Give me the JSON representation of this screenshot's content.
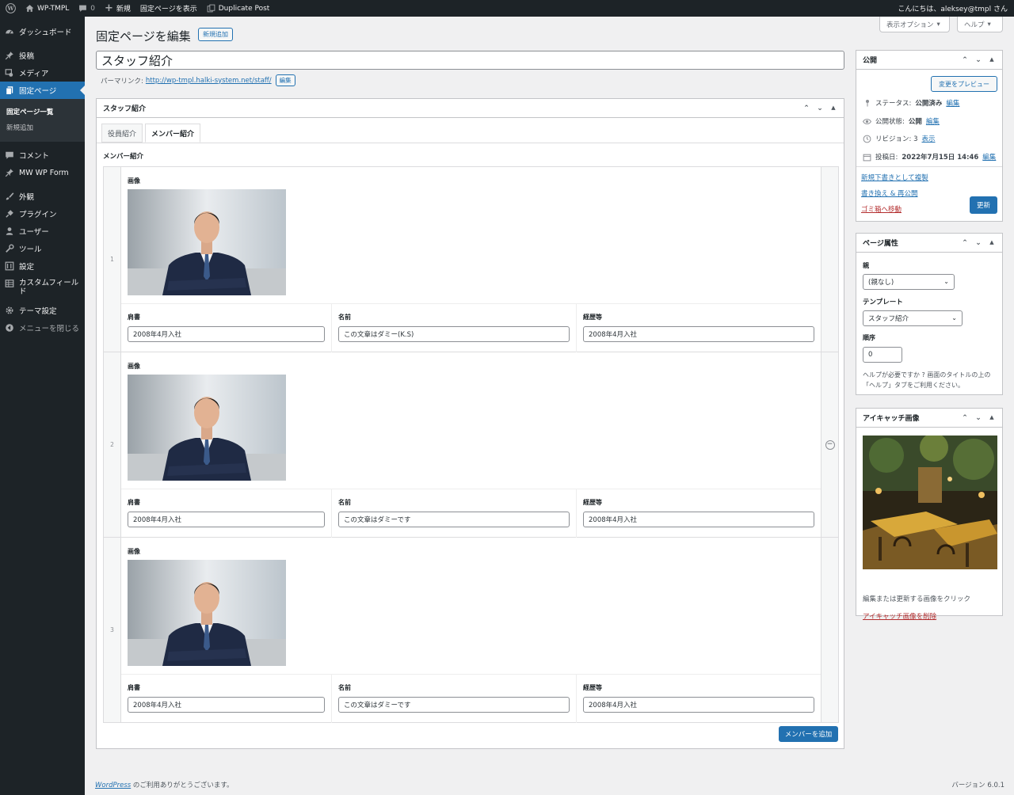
{
  "adminbar": {
    "site_name": "WP-TMPL",
    "comments_count": "0",
    "new_label": "新規",
    "view_page": "固定ページを表示",
    "duplicate_post": "Duplicate Post",
    "greeting": "こんにちは、aleksey@tmpl さん"
  },
  "sidebar": {
    "dashboard": "ダッシュボード",
    "posts": "投稿",
    "media": "メディア",
    "pages": "固定ページ",
    "pages_list": "固定ページ一覧",
    "pages_new": "新規追加",
    "comments": "コメント",
    "mw_form": "MW WP Form",
    "appearance": "外観",
    "plugins": "プラグイン",
    "users": "ユーザー",
    "tools": "ツール",
    "settings": "設定",
    "custom_fields": "カスタムフィールド",
    "theme_settings": "テーマ設定",
    "collapse": "メニューを閉じる"
  },
  "header": {
    "screen_options": "表示オプション",
    "help": "ヘルプ",
    "page_title": "固定ページを編集",
    "add_new": "新規追加"
  },
  "editor": {
    "post_title": "スタッフ紹介",
    "permalink_label": "パーマリンク:",
    "permalink_url": "http://wp-tmpl.halki-system.net/staff/",
    "permalink_edit": "編集"
  },
  "staff_box": {
    "title": "スタッフ紹介",
    "tabs": [
      "役員紹介",
      "メンバー紹介"
    ],
    "field_label": "メンバー紹介",
    "image_label": "画像",
    "col_title": "肩書",
    "col_name": "名前",
    "col_career": "経歴等",
    "rows": [
      {
        "num": "1",
        "title": "2008年4月入社",
        "name": "この文章はダミー(K.S)",
        "career": "2008年4月入社"
      },
      {
        "num": "2",
        "title": "2008年4月入社",
        "name": "この文章はダミーです",
        "career": "2008年4月入社"
      },
      {
        "num": "3",
        "title": "2008年4月入社",
        "name": "この文章はダミーです",
        "career": "2008年4月入社"
      }
    ],
    "add_member": "メンバーを追加"
  },
  "publish": {
    "title": "公開",
    "preview": "変更をプレビュー",
    "status_label": "ステータス:",
    "status_value": "公開済み",
    "visibility_label": "公開状態:",
    "visibility_value": "公開",
    "revisions_label": "リビジョン: 3",
    "revisions_link": "表示",
    "published_label": "投稿日:",
    "published_value": "2022年7月15日 14:46",
    "edit": "編集",
    "new_draft": "新規下書きとして複製",
    "rewrite": "書き換え & 再公開",
    "trash": "ゴミ箱へ移動",
    "update": "更新"
  },
  "page_attrs": {
    "title": "ページ属性",
    "parent_label": "親",
    "parent_value": "(親なし)",
    "template_label": "テンプレート",
    "template_value": "スタッフ紹介",
    "order_label": "順序",
    "order_value": "0",
    "help_text": "ヘルプが必要ですか ? 画面のタイトルの上の「ヘルプ」タブをご利用ください。"
  },
  "featured": {
    "title": "アイキャッチ画像",
    "hint": "編集または更新する画像をクリック",
    "remove": "アイキャッチ画像を削除"
  },
  "footer": {
    "wp_link": "WordPress",
    "thanks": " のご利用ありがとうございます。",
    "version": "バージョン 6.0.1"
  },
  "colors": {
    "admin_dark": "#1d2327",
    "accent": "#2271b1",
    "trash": "#b32d2e"
  }
}
